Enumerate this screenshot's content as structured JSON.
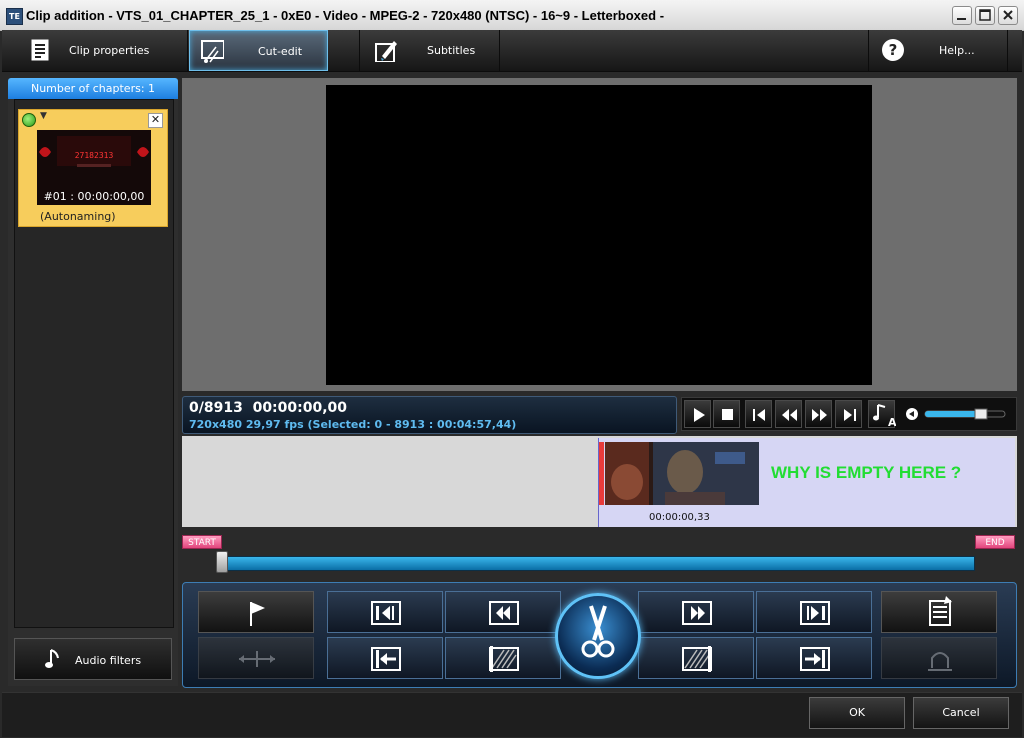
{
  "window": {
    "title": "Clip addition - VTS_01_CHAPTER_25_1 - 0xE0 - Video - MPEG-2 - 720x480 (NTSC) - 16~9 - Letterboxed -",
    "app_icon_text": "TE"
  },
  "tabs": [
    {
      "label": "Clip properties",
      "icon": "clip-properties-icon"
    },
    {
      "label": "Cut-edit",
      "icon": "cut-edit-icon",
      "active": true
    },
    {
      "label": "Subtitles",
      "icon": "subtitles-icon"
    }
  ],
  "help": {
    "label": "Help...",
    "icon": "help-icon"
  },
  "chapters": {
    "header": "Number of chapters: 1",
    "items": [
      {
        "time": "#01 : 00:00:00,00",
        "name": "(Autonaming)",
        "thumb_text": "27182313"
      }
    ]
  },
  "audio_filters": {
    "label": "Audio filters",
    "icon": "music-note-icon"
  },
  "playback": {
    "frames": "0/8913",
    "timecode": "00:00:00,00",
    "details": "720x480 29,97  fps  (Selected: 0 - 8913 : 00:04:57,44)"
  },
  "timeline": {
    "clip_time": "00:00:00,33",
    "note": "WHY IS EMPTY HERE ?"
  },
  "range": {
    "start_label": "START",
    "end_label": "END",
    "selection_start": 0,
    "selection_end": 8913
  },
  "volume": {
    "level": 0.7
  },
  "buttons": {
    "ok": "OK",
    "cancel": "Cancel"
  },
  "colors": {
    "accent": "#4aa8d8",
    "chapter_card": "#f7cd5c",
    "note_text": "#22dd33"
  }
}
